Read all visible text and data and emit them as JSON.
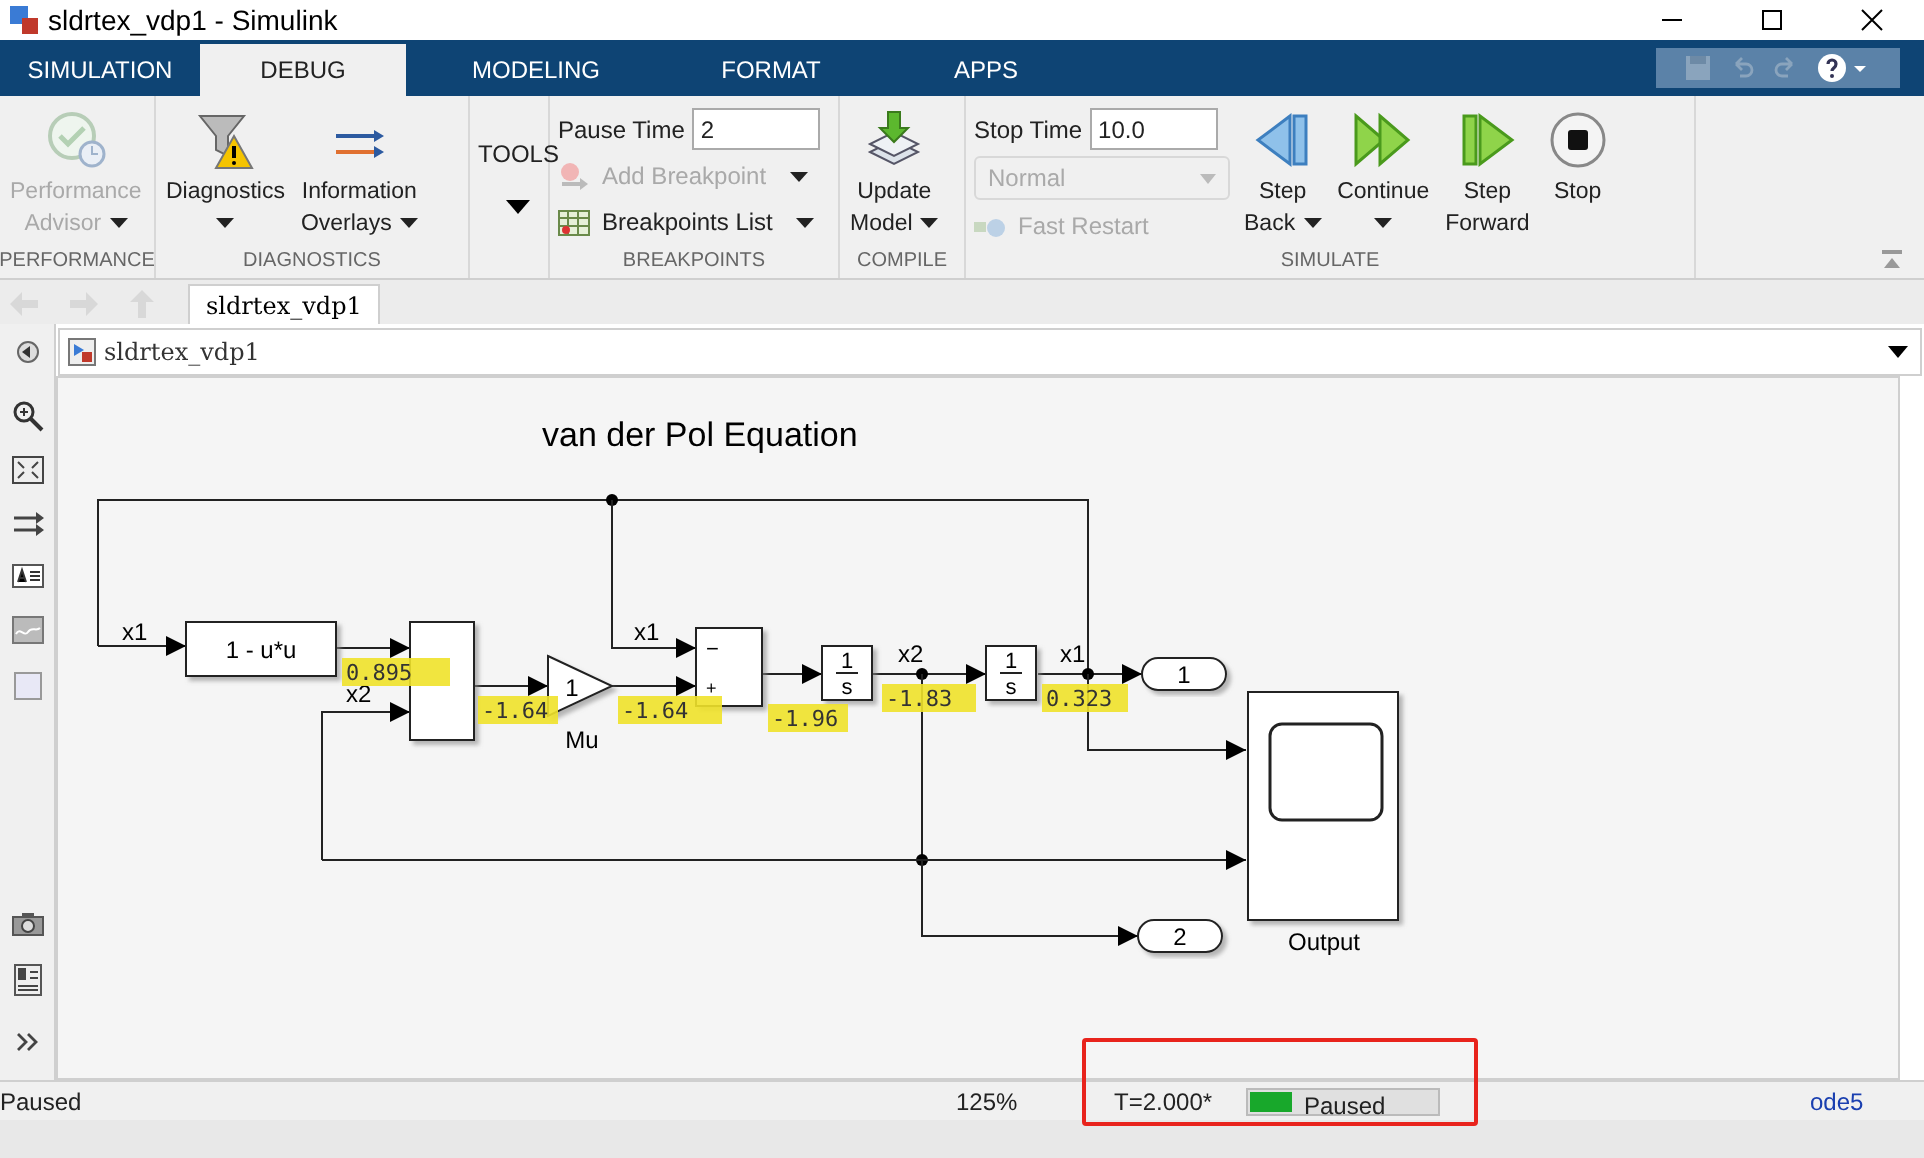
{
  "window": {
    "title": "sldrtex_vdp1 - Simulink"
  },
  "tabs": [
    {
      "label": "SIMULATION",
      "selected": false
    },
    {
      "label": "DEBUG",
      "selected": true
    },
    {
      "label": "MODELING",
      "selected": false
    },
    {
      "label": "FORMAT",
      "selected": false
    },
    {
      "label": "APPS",
      "selected": false
    }
  ],
  "ribbon": {
    "sections": [
      {
        "label": "PERFORMANCE",
        "items": [
          {
            "kind": "large",
            "lines": [
              "Performance",
              "Advisor"
            ],
            "caret": true,
            "disabled": true
          }
        ]
      },
      {
        "label": "DIAGNOSTICS",
        "items": [
          {
            "kind": "large",
            "lines": [
              "Diagnostics"
            ],
            "caret": true,
            "disabled": false
          },
          {
            "kind": "large",
            "lines": [
              "Information",
              "Overlays"
            ],
            "caret": true,
            "disabled": false
          }
        ]
      },
      {
        "items": [
          {
            "kind": "tools",
            "lines": [
              "TOOLS"
            ],
            "caret": true,
            "disabled": false
          }
        ]
      },
      {
        "label": "BREAKPOINTS",
        "items": [
          {
            "kind": "field",
            "lines": [
              "Pause Time"
            ],
            "value": "2",
            "disabled": false
          },
          {
            "kind": "small",
            "lines": [
              "Add Breakpoint"
            ],
            "caret": true,
            "disabled": true
          },
          {
            "kind": "small",
            "lines": [
              "Breakpoints List"
            ],
            "caret": true,
            "disabled": false
          }
        ]
      },
      {
        "label": "COMPILE",
        "items": [
          {
            "kind": "large",
            "lines": [
              "Update",
              "Model"
            ],
            "caret": true,
            "disabled": false
          }
        ]
      },
      {
        "label": "SIMULATE",
        "items": [
          {
            "kind": "field",
            "lines": [
              "Stop Time"
            ],
            "value": "10.0",
            "disabled": false
          },
          {
            "kind": "dropdown",
            "lines": [
              "Normal"
            ],
            "disabled": true
          },
          {
            "kind": "small",
            "lines": [
              "Fast Restart"
            ],
            "caret": false,
            "disabled": true
          },
          {
            "kind": "large",
            "lines": [
              "Step",
              "Back"
            ],
            "caret": true,
            "disabled": false
          },
          {
            "kind": "large",
            "lines": [
              "Continue"
            ],
            "caret": true,
            "disabled": false
          },
          {
            "kind": "large",
            "lines": [
              "Step",
              "Forward"
            ],
            "caret": false,
            "disabled": false
          },
          {
            "kind": "large",
            "lines": [
              "Stop"
            ],
            "caret": false,
            "disabled": false
          }
        ]
      }
    ]
  },
  "model_tab": {
    "label": "sldrtex_vdp1"
  },
  "address": {
    "path": "sldrtex_vdp1"
  },
  "diagram": {
    "title": "van der Pol Equation",
    "blocks": [
      {
        "text": "1 - u*u"
      },
      {
        "text": "1"
      },
      {
        "text": "1"
      },
      {
        "text": "2"
      }
    ],
    "integrators": [
      {
        "numerator": "1",
        "denominator": "s"
      },
      {
        "numerator": "1",
        "denominator": "s"
      }
    ],
    "sum_signs": [
      "−",
      "+"
    ],
    "block_labels": [
      "Mu",
      "Output"
    ],
    "signal_labels": [
      "x1",
      "x2",
      "x1",
      "x2",
      "x1"
    ],
    "values": [
      "0.895",
      "-1.64",
      "-1.64",
      "-1.96",
      "-1.83",
      "0.323"
    ]
  },
  "status_bar": {
    "state": "Paused",
    "zoom": "125%",
    "time": "T=2.000*",
    "progress": {
      "label": "Paused",
      "level": 0.22
    },
    "solver": "ode5"
  }
}
